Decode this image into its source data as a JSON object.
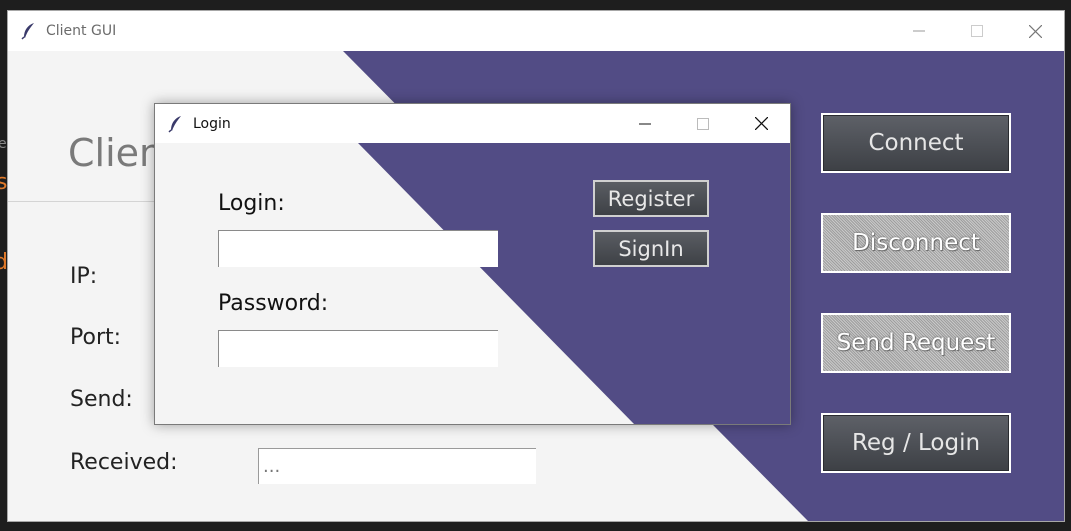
{
  "main_window": {
    "title": "Client GUI",
    "client_title": "Client",
    "labels": {
      "ip": "IP:",
      "port": "Port:",
      "send": "Send:",
      "received": "Received:"
    },
    "received_value": "...",
    "buttons": {
      "connect": "Connect",
      "disconnect": "Disconnect",
      "send_request": "Send Request",
      "reg_login": "Reg / Login"
    }
  },
  "login_dialog": {
    "title": "Login",
    "login_label": "Login:",
    "password_label": "Password:",
    "login_value": "",
    "password_value": "",
    "buttons": {
      "register": "Register",
      "signin": "SignIn"
    }
  },
  "background_window_fragments": [
    "e",
    "s",
    "d"
  ],
  "icons": {
    "app": "feather-icon",
    "minimize": "minimize-icon",
    "maximize": "maximize-icon",
    "close": "close-icon"
  },
  "colors": {
    "accent_purple": "#524c85",
    "window_bg": "#f4f4f4",
    "button_dark": "#4a4d52",
    "background_orange_text": "#e0792a"
  }
}
